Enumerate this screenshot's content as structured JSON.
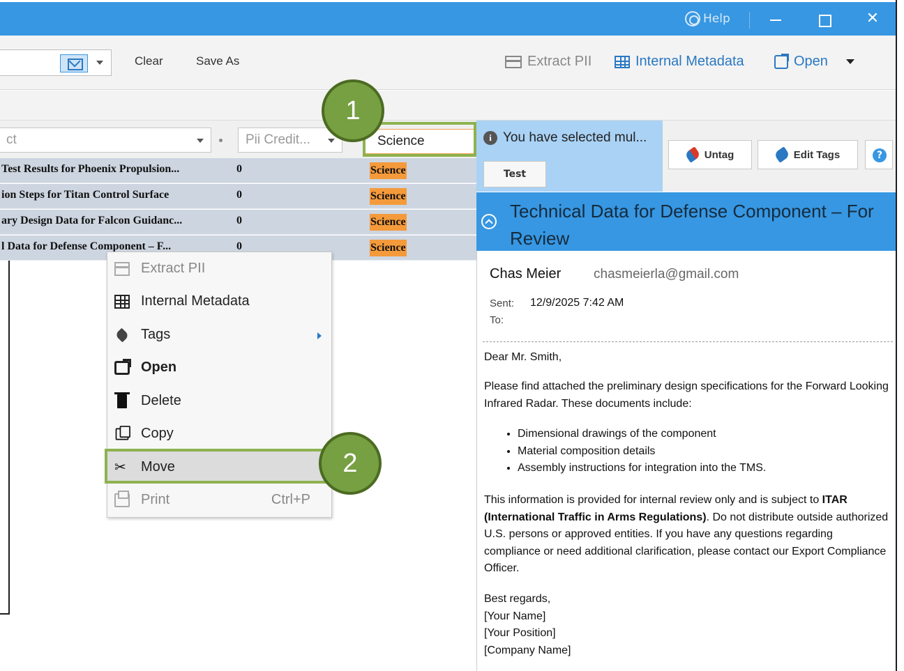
{
  "titlebar": {
    "help_label": "Help",
    "min_glyph": "",
    "max_glyph": "",
    "close_glyph": "✕"
  },
  "toolbar": {
    "clear_label": "Clear",
    "save_as_label": "Save As",
    "extract_pii_label": "Extract PII",
    "internal_metadata_label": "Internal Metadata",
    "open_label": "Open"
  },
  "filters": {
    "subject_placeholder": "ct",
    "pii_placeholder": "Pii Credit...",
    "tag_value": "Science"
  },
  "rows": [
    {
      "subject": "Test Results for Phoenix Propulsion...",
      "count": "0",
      "tag": "Science"
    },
    {
      "subject": "ion Steps for Titan Control Surface",
      "count": "0",
      "tag": "Science"
    },
    {
      "subject": "ary Design Data for Falcon Guidanc...",
      "count": "0",
      "tag": "Science"
    },
    {
      "subject": "l Data for Defense Component – F...",
      "count": "0",
      "tag": "Science"
    }
  ],
  "preview": {
    "notice": "You have selected mul...",
    "test_button": "Test",
    "untag_button": "Untag",
    "edit_tags_button": "Edit Tags",
    "help_glyph": "?",
    "subject": "Technical Data for Defense Component – For Review",
    "sender_name": "Chas Meier",
    "sender_email": "chasmeierla@gmail.com",
    "sent_label": "Sent:",
    "sent_value": "12/9/2025 7:42 AM",
    "to_label": "To:",
    "greeting": "Dear Mr. Smith,",
    "para1": "Please find attached the preliminary design specifications for the Forward Looking Infrared Radar. These documents include:",
    "bullets": [
      "Dimensional drawings of the component",
      "Material composition details",
      "Assembly instructions for integration into the TMS."
    ],
    "para2_a": "This information is provided for internal review only and is subject to ",
    "para2_bold": "ITAR (International Traffic in Arms Regulations)",
    "para2_b": ". Do not distribute outside authorized U.S. persons or approved entities. If you have any questions regarding compliance or need additional clarification, please contact our Export Compliance Officer.",
    "sign1": "Best regards,",
    "sign2": "[Your Name]",
    "sign3": "[Your Position]",
    "sign4": "[Company Name]"
  },
  "context_menu": {
    "extract_pii": "Extract PII",
    "internal_metadata": "Internal Metadata",
    "tags": "Tags",
    "open": "Open",
    "delete": "Delete",
    "copy": "Copy",
    "move": "Move",
    "print": "Print",
    "print_shortcut": "Ctrl+P"
  },
  "callouts": {
    "one": "1",
    "two": "2"
  },
  "colors": {
    "accent": "#3797e2",
    "tag": "#f59a3b",
    "highlight": "#8db250",
    "callout": "#76a042"
  }
}
